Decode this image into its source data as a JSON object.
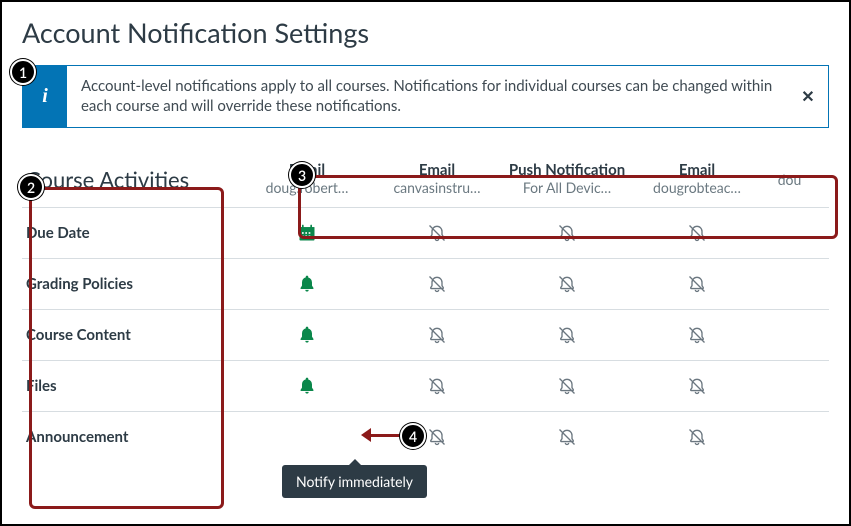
{
  "page_title": "Account Notification Settings",
  "banner": {
    "text": "Account-level notifications apply to all courses. Notifications for individual courses can be changed within each course and will override these notifications.",
    "close_label": "✕"
  },
  "section_heading": "Course Activities",
  "channels": [
    {
      "type": "Email",
      "address": "doug.robert…"
    },
    {
      "type": "Email",
      "address": "canvasinstru…"
    },
    {
      "type": "Push Notification",
      "address": "For All Devic…"
    },
    {
      "type": "Email",
      "address": "dougrobteac…"
    },
    {
      "type": "",
      "address": "dou"
    }
  ],
  "rows": [
    {
      "label": "Due Date",
      "cells": [
        "calendar",
        "off",
        "off",
        "off"
      ]
    },
    {
      "label": "Grading Policies",
      "cells": [
        "immediate",
        "off",
        "off",
        "off"
      ]
    },
    {
      "label": "Course Content",
      "cells": [
        "immediate",
        "off",
        "off",
        "off"
      ]
    },
    {
      "label": "Files",
      "cells": [
        "immediate",
        "off",
        "off",
        "off"
      ]
    },
    {
      "label": "Announcement",
      "cells": [
        "blank",
        "off",
        "off",
        "off"
      ]
    }
  ],
  "tooltip_text": "Notify immediately",
  "callouts": {
    "1": "1",
    "2": "2",
    "3": "3",
    "4": "4"
  },
  "icon_colors": {
    "on": "#0B874B",
    "off": "#6b7780"
  }
}
